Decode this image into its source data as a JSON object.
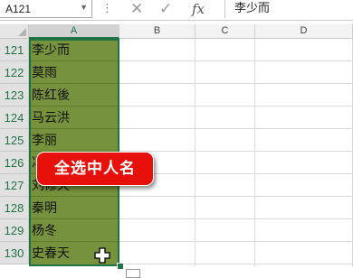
{
  "formula_bar": {
    "name_box": "A121",
    "name_box_arrow": "▼",
    "more_dots": "⋮",
    "cancel_icon": "✕",
    "enter_icon": "✓",
    "fx_label": "fx",
    "formula_value": "李少而"
  },
  "columns": [
    "A",
    "B",
    "C",
    "D"
  ],
  "rows": [
    {
      "num": "121",
      "name": "李少而"
    },
    {
      "num": "122",
      "name": "莫雨"
    },
    {
      "num": "123",
      "name": "陈红後"
    },
    {
      "num": "124",
      "name": "马云洪"
    },
    {
      "num": "125",
      "name": "李丽"
    },
    {
      "num": "126",
      "name": "冯"
    },
    {
      "num": "127",
      "name": "刘修天"
    },
    {
      "num": "128",
      "name": "秦明"
    },
    {
      "num": "129",
      "name": "杨冬"
    },
    {
      "num": "130",
      "name": "史春天"
    }
  ],
  "callout": {
    "text": "全选中人名"
  },
  "colors": {
    "selection_fill": "#76923c",
    "selection_border": "#217346",
    "callout_bg": "#e8100b",
    "header_accent": "#217346"
  },
  "icons": {
    "cancel": "cancel-icon",
    "enter": "enter-icon",
    "function": "fx-icon",
    "cursor": "cross-cursor-icon",
    "paste_options": "paste-options-icon"
  }
}
